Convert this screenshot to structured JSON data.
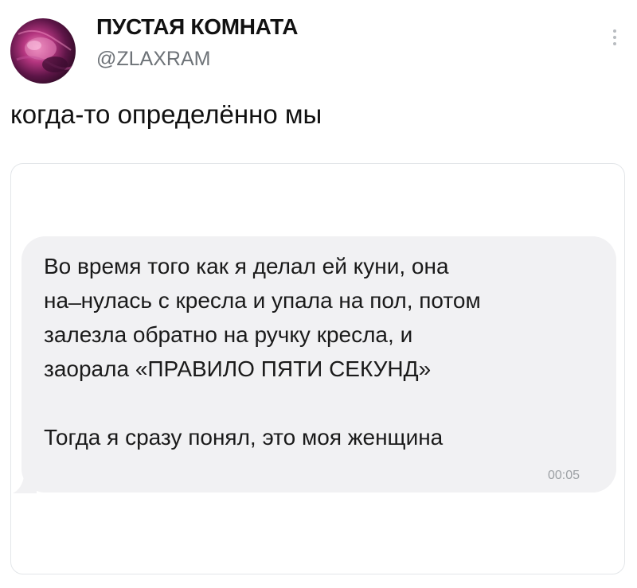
{
  "author": {
    "display_name": "ПУСТАЯ КОМНАТА",
    "handle": "@ZLAXRAM",
    "avatar_icon": "profile-avatar"
  },
  "tweet": {
    "text": "когда-то определённо мы"
  },
  "more_menu": {
    "icon": "vertical-dots-icon"
  },
  "message": {
    "lines": [
      "Во время того как я делал ей куни, она",
      "на ̶ нулась с кресла и упала на пол, потом",
      "залезла обратно на ручку кресла, и",
      "заорала «ПРАВИЛО ПЯТИ СЕКУНД»"
    ],
    "last_line": "Тогда я сразу понял, это моя женщина",
    "time": "00:05"
  },
  "colors": {
    "bubble": "#f1f1f3",
    "handle": "#6e7378",
    "time": "#9ca0a4",
    "card_border": "#e3e6e9"
  }
}
